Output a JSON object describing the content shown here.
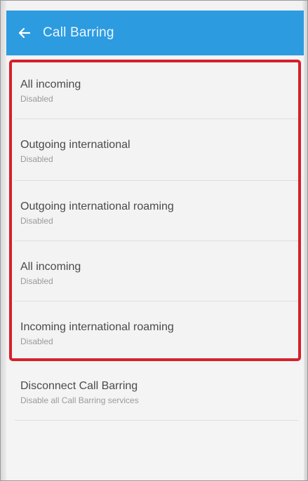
{
  "app_bar": {
    "back_icon": "arrow-left-icon",
    "title": "Call Barring",
    "color": "#2d9be0"
  },
  "barring_items": [
    {
      "title": "All incoming",
      "status": "Disabled"
    },
    {
      "title": "Outgoing international",
      "status": "Disabled"
    },
    {
      "title": "Outgoing international roaming",
      "status": "Disabled"
    },
    {
      "title": "All incoming",
      "status": "Disabled"
    },
    {
      "title": "Incoming international roaming",
      "status": "Disabled"
    }
  ],
  "disconnect_item": {
    "title": "Disconnect Call Barring",
    "subtitle": "Disable all Call Barring services"
  },
  "highlight_color": "#d6202a"
}
